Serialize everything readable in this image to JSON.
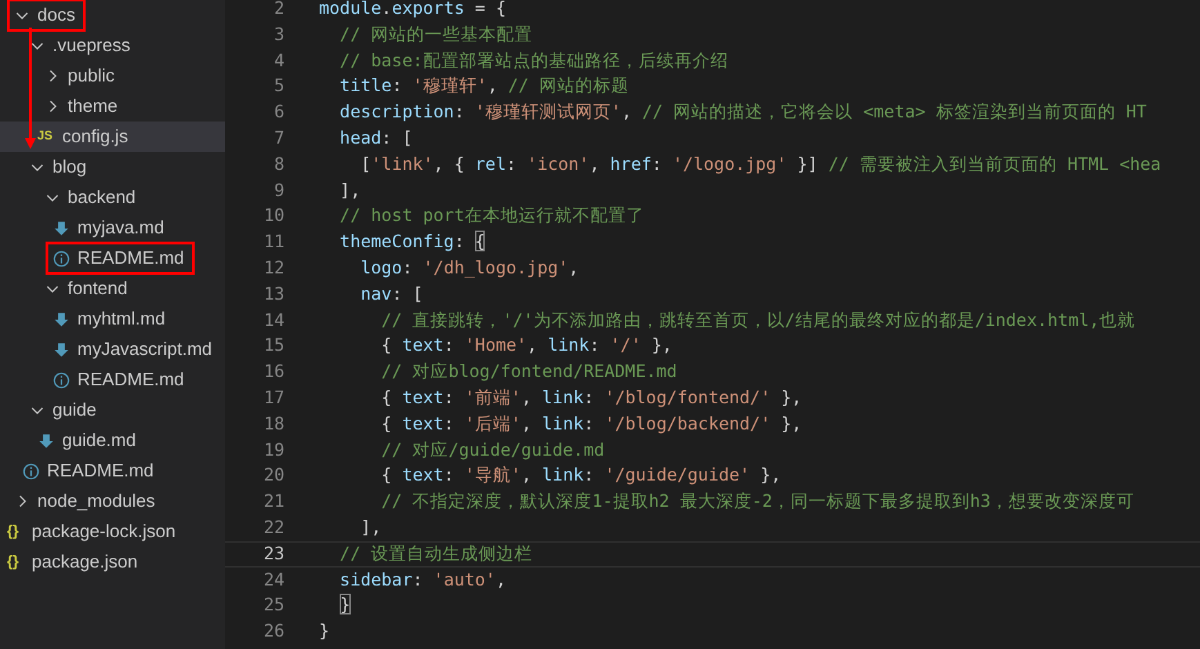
{
  "explorer": {
    "items": [
      {
        "name": "docs",
        "kind": "folder",
        "expanded": true,
        "selected": false,
        "highlighted": true,
        "children": [
          {
            "name": ".vuepress",
            "kind": "folder",
            "expanded": true,
            "selected": false,
            "highlighted": false,
            "children": [
              {
                "name": "public",
                "kind": "folder",
                "expanded": false,
                "selected": false,
                "highlighted": false
              },
              {
                "name": "theme",
                "kind": "folder",
                "expanded": false,
                "selected": false,
                "highlighted": false
              },
              {
                "name": "config.js",
                "kind": "js",
                "badge": "JS",
                "selected": true,
                "highlighted": false
              }
            ]
          },
          {
            "name": "blog",
            "kind": "folder",
            "expanded": true,
            "selected": false,
            "highlighted": false,
            "children": [
              {
                "name": "backend",
                "kind": "folder",
                "expanded": true,
                "selected": false,
                "highlighted": false,
                "children": [
                  {
                    "name": "myjava.md",
                    "kind": "md",
                    "selected": false,
                    "highlighted": false
                  },
                  {
                    "name": "README.md",
                    "kind": "info",
                    "selected": false,
                    "highlighted": true
                  }
                ]
              },
              {
                "name": "fontend",
                "kind": "folder",
                "expanded": true,
                "selected": false,
                "highlighted": false,
                "children": [
                  {
                    "name": "myhtml.md",
                    "kind": "md",
                    "selected": false,
                    "highlighted": false
                  },
                  {
                    "name": "myJavascript.md",
                    "kind": "md",
                    "selected": false,
                    "highlighted": false
                  },
                  {
                    "name": "README.md",
                    "kind": "info",
                    "selected": false,
                    "highlighted": false
                  }
                ]
              }
            ]
          },
          {
            "name": "guide",
            "kind": "folder",
            "expanded": true,
            "selected": false,
            "highlighted": false,
            "children": [
              {
                "name": "guide.md",
                "kind": "md",
                "selected": false,
                "highlighted": false
              }
            ]
          },
          {
            "name": "README.md",
            "kind": "info",
            "selected": false,
            "highlighted": false
          }
        ]
      },
      {
        "name": "node_modules",
        "kind": "folder",
        "expanded": false,
        "selected": false,
        "highlighted": false
      },
      {
        "name": "package-lock.json",
        "kind": "json",
        "badge": "{}",
        "selected": false,
        "highlighted": false
      },
      {
        "name": "package.json",
        "kind": "json",
        "badge": "{}",
        "selected": false,
        "highlighted": false
      }
    ]
  },
  "editor": {
    "lines": [
      {
        "number": "2",
        "current": false,
        "tokens": [
          {
            "kind": "key",
            "text": "module"
          },
          {
            "kind": "punct",
            "text": "."
          },
          {
            "kind": "key",
            "text": "exports"
          },
          {
            "kind": "punct",
            "text": " = {"
          }
        ]
      },
      {
        "number": "3",
        "current": false,
        "tokens": [
          {
            "kind": "comment",
            "text": "  // 网站的一些基本配置"
          }
        ]
      },
      {
        "number": "4",
        "current": false,
        "tokens": [
          {
            "kind": "comment",
            "text": "  // base:配置部署站点的基础路径，后续再介绍"
          }
        ]
      },
      {
        "number": "5",
        "current": false,
        "tokens": [
          {
            "kind": "key",
            "text": "  title"
          },
          {
            "kind": "punct",
            "text": ": "
          },
          {
            "kind": "string",
            "text": "'穆瑾轩'"
          },
          {
            "kind": "punct",
            "text": ", "
          },
          {
            "kind": "comment",
            "text": "// 网站的标题"
          }
        ]
      },
      {
        "number": "6",
        "current": false,
        "tokens": [
          {
            "kind": "key",
            "text": "  description"
          },
          {
            "kind": "punct",
            "text": ": "
          },
          {
            "kind": "string",
            "text": "'穆瑾轩测试网页'"
          },
          {
            "kind": "punct",
            "text": ", "
          },
          {
            "kind": "comment",
            "text": "// 网站的描述，它将会以 <meta> 标签渲染到当前页面的 HT"
          }
        ]
      },
      {
        "number": "7",
        "current": false,
        "tokens": [
          {
            "kind": "key",
            "text": "  head"
          },
          {
            "kind": "punct",
            "text": ": ["
          }
        ]
      },
      {
        "number": "8",
        "current": false,
        "tokens": [
          {
            "kind": "punct",
            "text": "    ["
          },
          {
            "kind": "string",
            "text": "'link'"
          },
          {
            "kind": "punct",
            "text": ", { "
          },
          {
            "kind": "key",
            "text": "rel"
          },
          {
            "kind": "punct",
            "text": ": "
          },
          {
            "kind": "string",
            "text": "'icon'"
          },
          {
            "kind": "punct",
            "text": ", "
          },
          {
            "kind": "key",
            "text": "href"
          },
          {
            "kind": "punct",
            "text": ": "
          },
          {
            "kind": "string",
            "text": "'/logo.jpg'"
          },
          {
            "kind": "punct",
            "text": " }] "
          },
          {
            "kind": "comment",
            "text": "// 需要被注入到当前页面的 HTML <hea"
          }
        ]
      },
      {
        "number": "9",
        "current": false,
        "tokens": [
          {
            "kind": "punct",
            "text": "  ],"
          }
        ]
      },
      {
        "number": "10",
        "current": false,
        "tokens": [
          {
            "kind": "comment",
            "text": "  // host port在本地运行就不配置了"
          }
        ]
      },
      {
        "number": "11",
        "current": false,
        "tokens": [
          {
            "kind": "key",
            "text": "  themeConfig"
          },
          {
            "kind": "punct",
            "text": ": "
          },
          {
            "kind": "match",
            "text": "{"
          }
        ]
      },
      {
        "number": "12",
        "current": false,
        "tokens": [
          {
            "kind": "key",
            "text": "    logo"
          },
          {
            "kind": "punct",
            "text": ": "
          },
          {
            "kind": "string",
            "text": "'/dh_logo.jpg'"
          },
          {
            "kind": "punct",
            "text": ","
          }
        ]
      },
      {
        "number": "13",
        "current": false,
        "tokens": [
          {
            "kind": "key",
            "text": "    nav"
          },
          {
            "kind": "punct",
            "text": ": ["
          }
        ]
      },
      {
        "number": "14",
        "current": false,
        "tokens": [
          {
            "kind": "comment",
            "text": "      // 直接跳转，'/'为不添加路由，跳转至首页，以/结尾的最终对应的都是/index.html,也就"
          }
        ]
      },
      {
        "number": "15",
        "current": false,
        "tokens": [
          {
            "kind": "punct",
            "text": "      { "
          },
          {
            "kind": "key",
            "text": "text"
          },
          {
            "kind": "punct",
            "text": ": "
          },
          {
            "kind": "string",
            "text": "'Home'"
          },
          {
            "kind": "punct",
            "text": ", "
          },
          {
            "kind": "key",
            "text": "link"
          },
          {
            "kind": "punct",
            "text": ": "
          },
          {
            "kind": "string",
            "text": "'/'"
          },
          {
            "kind": "punct",
            "text": " },"
          }
        ]
      },
      {
        "number": "16",
        "current": false,
        "tokens": [
          {
            "kind": "comment",
            "text": "      // 对应blog/fontend/README.md"
          }
        ]
      },
      {
        "number": "17",
        "current": false,
        "tokens": [
          {
            "kind": "punct",
            "text": "      { "
          },
          {
            "kind": "key",
            "text": "text"
          },
          {
            "kind": "punct",
            "text": ": "
          },
          {
            "kind": "string",
            "text": "'前端'"
          },
          {
            "kind": "punct",
            "text": ", "
          },
          {
            "kind": "key",
            "text": "link"
          },
          {
            "kind": "punct",
            "text": ": "
          },
          {
            "kind": "string",
            "text": "'/blog/fontend/'"
          },
          {
            "kind": "punct",
            "text": " },"
          }
        ]
      },
      {
        "number": "18",
        "current": false,
        "tokens": [
          {
            "kind": "punct",
            "text": "      { "
          },
          {
            "kind": "key",
            "text": "text"
          },
          {
            "kind": "punct",
            "text": ": "
          },
          {
            "kind": "string",
            "text": "'后端'"
          },
          {
            "kind": "punct",
            "text": ", "
          },
          {
            "kind": "key",
            "text": "link"
          },
          {
            "kind": "punct",
            "text": ": "
          },
          {
            "kind": "string",
            "text": "'/blog/backend/'"
          },
          {
            "kind": "punct",
            "text": " },"
          }
        ]
      },
      {
        "number": "19",
        "current": false,
        "tokens": [
          {
            "kind": "comment",
            "text": "      // 对应/guide/guide.md"
          }
        ]
      },
      {
        "number": "20",
        "current": false,
        "tokens": [
          {
            "kind": "punct",
            "text": "      { "
          },
          {
            "kind": "key",
            "text": "text"
          },
          {
            "kind": "punct",
            "text": ": "
          },
          {
            "kind": "string",
            "text": "'导航'"
          },
          {
            "kind": "punct",
            "text": ", "
          },
          {
            "kind": "key",
            "text": "link"
          },
          {
            "kind": "punct",
            "text": ": "
          },
          {
            "kind": "string",
            "text": "'/guide/guide'"
          },
          {
            "kind": "punct",
            "text": " },"
          }
        ]
      },
      {
        "number": "21",
        "current": false,
        "tokens": [
          {
            "kind": "comment",
            "text": "      // 不指定深度，默认深度1-提取h2 最大深度-2，同一标题下最多提取到h3，想要改变深度可"
          }
        ]
      },
      {
        "number": "22",
        "current": false,
        "tokens": [
          {
            "kind": "punct",
            "text": "    ],"
          }
        ]
      },
      {
        "number": "23",
        "current": true,
        "tokens": [
          {
            "kind": "comment",
            "text": "  // 设置自动生成侧边栏"
          }
        ]
      },
      {
        "number": "24",
        "current": false,
        "tokens": [
          {
            "kind": "key",
            "text": "  sidebar"
          },
          {
            "kind": "punct",
            "text": ": "
          },
          {
            "kind": "string",
            "text": "'auto'"
          },
          {
            "kind": "punct",
            "text": ","
          }
        ]
      },
      {
        "number": "25",
        "current": false,
        "tokens": [
          {
            "kind": "match",
            "text": "  }"
          }
        ]
      },
      {
        "number": "26",
        "current": false,
        "tokens": [
          {
            "kind": "punct",
            "text": "}"
          }
        ]
      }
    ]
  }
}
